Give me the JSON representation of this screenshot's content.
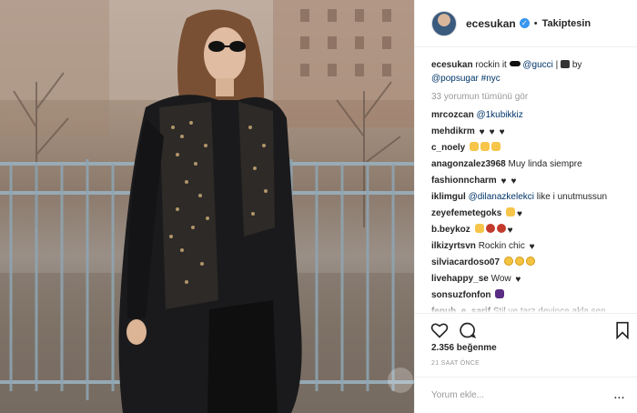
{
  "photo": {
    "alt": ""
  },
  "header": {
    "username": "ecesukan",
    "separator": "•",
    "follow_status": "Takiptesin"
  },
  "caption": {
    "username": "ecesukan",
    "text_1": " rockin it ",
    "mention_1": "@gucci",
    "text_2": " | ",
    "text_3": " by",
    "mention_2": "@popsugar",
    "hashtag": "#nyc"
  },
  "load_more": "33 yorumun tümünü gör",
  "comments": [
    {
      "user": "mrcozcan",
      "text": "",
      "mention": "@1kubikkiz",
      "emoji": []
    },
    {
      "user": "mehdikrm",
      "text": "",
      "mention": "",
      "emoji": [
        "heart",
        "heart",
        "heart"
      ]
    },
    {
      "user": "c_noely",
      "text": "",
      "mention": "",
      "emoji": [
        "clap",
        "clap",
        "clap"
      ]
    },
    {
      "user": "anagonzalez3968",
      "text": "Muy linda siempre",
      "mention": "",
      "emoji": []
    },
    {
      "user": "fashionncharm",
      "text": "",
      "mention": "",
      "emoji": [
        "heart",
        "heart"
      ]
    },
    {
      "user": "iklimgul",
      "text": "like i unutmussun",
      "mention": "@dilanazkelekci",
      "emoji": []
    },
    {
      "user": "zeyefemetegoks",
      "text": "",
      "mention": "",
      "emoji": [
        "clap",
        "heart"
      ]
    },
    {
      "user": "b.beykoz",
      "text": "",
      "mention": "",
      "emoji": [
        "clap",
        "rose",
        "rose",
        "heart"
      ]
    },
    {
      "user": "ilkizyrtsvn",
      "text": "Rockin chic",
      "mention": "",
      "emoji": [
        "heart"
      ]
    },
    {
      "user": "silviacardoso07",
      "text": "",
      "mention": "",
      "emoji": [
        "face",
        "face",
        "face"
      ]
    },
    {
      "user": "livehappy_se",
      "text": "Wow",
      "mention": "",
      "emoji": [
        "heart"
      ]
    },
    {
      "user": "sonsuzfonfon",
      "text": "",
      "mention": "",
      "emoji": [
        "skull"
      ]
    },
    {
      "user": "fenub_e_sarif",
      "text": "Stil ve tarz deyince akla sen",
      "mention": "",
      "emoji": []
    }
  ],
  "likes": "2.356 beğenme",
  "time": "21 SAAT ÖNCE",
  "add_comment": {
    "placeholder": "Yorum ekle..."
  },
  "more_label": "..."
}
